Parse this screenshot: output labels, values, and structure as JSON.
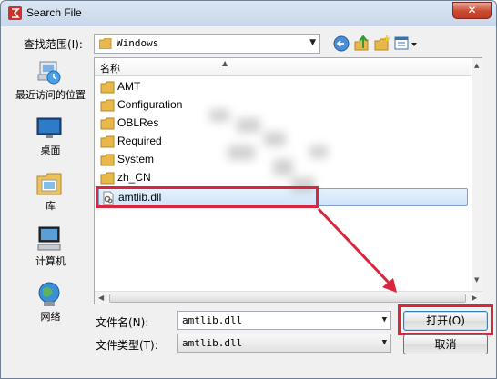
{
  "window": {
    "title": "Search File",
    "close_label": "✕"
  },
  "toolbar": {
    "look_in_label": "查找范围(I):",
    "look_in_value": "Windows"
  },
  "places": [
    {
      "label": "最近访问的位置",
      "icon": "recent-places-icon"
    },
    {
      "label": "桌面",
      "icon": "desktop-icon"
    },
    {
      "label": "库",
      "icon": "libraries-icon"
    },
    {
      "label": "计算机",
      "icon": "computer-icon"
    },
    {
      "label": "网络",
      "icon": "network-icon"
    }
  ],
  "filelist": {
    "header_name": "名称",
    "items": [
      {
        "name": "AMT",
        "type": "folder"
      },
      {
        "name": "Configuration",
        "type": "folder"
      },
      {
        "name": "OBLRes",
        "type": "folder"
      },
      {
        "name": "Required",
        "type": "folder"
      },
      {
        "name": "System",
        "type": "folder"
      },
      {
        "name": "zh_CN",
        "type": "folder"
      },
      {
        "name": "amtlib.dll",
        "type": "file",
        "selected": true
      }
    ]
  },
  "footer": {
    "filename_label": "文件名(N):",
    "filename_value": "amtlib.dll",
    "filetype_label": "文件类型(T):",
    "filetype_value": "amtlib.dll",
    "open_label": "打开(O)",
    "cancel_label": "取消"
  },
  "colors": {
    "highlight": "#d7263d",
    "selection": "#cfe4fa",
    "folder": "#e8b84a"
  }
}
